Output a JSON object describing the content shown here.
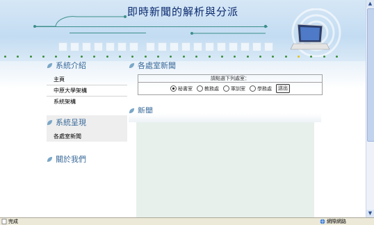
{
  "banner": {
    "title": "即時新聞的解析與分派"
  },
  "sections": {
    "intro": "系統介紹",
    "display": "系統呈現",
    "about": "關於我們",
    "office_news": "各處室新聞",
    "news": "新聞"
  },
  "intro_menu": [
    "主頁",
    "中原大學架構",
    "系統架構"
  ],
  "display_menu": [
    "各處室新聞"
  ],
  "form": {
    "header": "請點選下列處室：",
    "options": [
      "秘書室",
      "教務處",
      "軍訓室",
      "學務處"
    ],
    "selected": "秘書室",
    "submit_label": "送出"
  },
  "statusbar": {
    "left": "完成",
    "right": "網際網路"
  },
  "colors": {
    "section_text": "#3b6b9a",
    "banner_title": "#0b2a6e",
    "news_panel": "#e8f0ec"
  }
}
